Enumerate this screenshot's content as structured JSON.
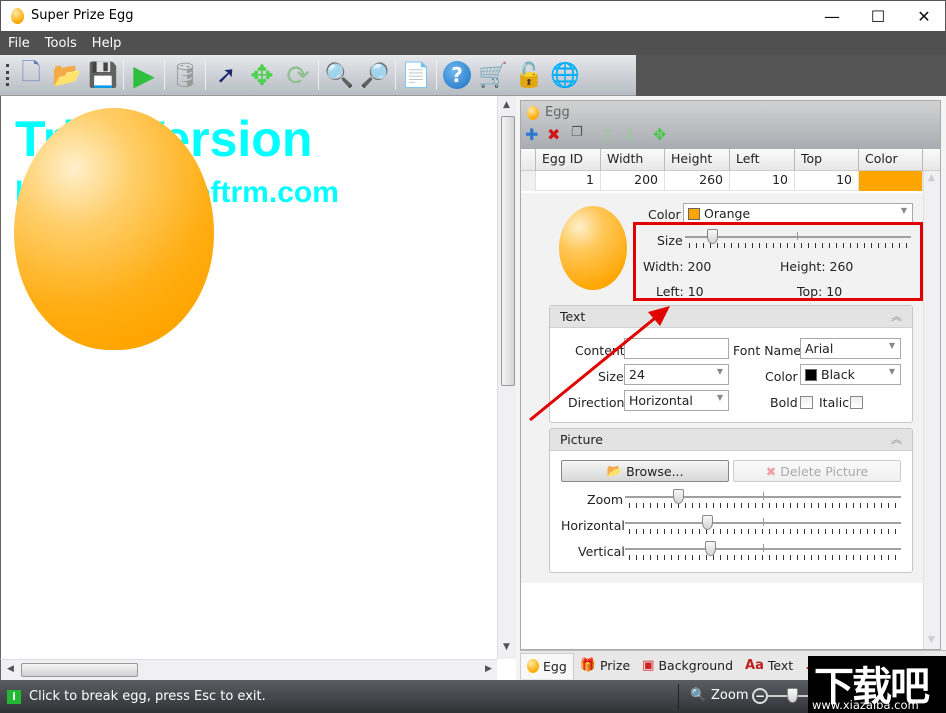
{
  "window": {
    "title": "Super Prize Egg",
    "controls": {
      "minimize": "—",
      "maximize": "☐",
      "close": "✕"
    }
  },
  "menu": [
    "File",
    "Tools",
    "Help"
  ],
  "toolbar": {
    "buttons": [
      {
        "name": "new",
        "icon": "new-document-icon",
        "glyph": "🗋"
      },
      {
        "name": "open",
        "icon": "open-folder-icon",
        "glyph": "📂"
      },
      {
        "name": "save",
        "icon": "save-disk-icon",
        "glyph": "💾"
      },
      {
        "name": "play",
        "icon": "play-icon",
        "glyph": "▶"
      },
      {
        "name": "database",
        "icon": "database-icon",
        "glyph": "🛢"
      },
      {
        "name": "select",
        "icon": "pointer-icon",
        "glyph": "➚"
      },
      {
        "name": "move",
        "icon": "move-arrows-icon",
        "glyph": "✥"
      },
      {
        "name": "reset",
        "icon": "refresh-icon",
        "glyph": "⟳"
      },
      {
        "name": "zoom-in",
        "icon": "zoom-in-icon",
        "glyph": "🔍"
      },
      {
        "name": "zoom-out",
        "icon": "zoom-out-icon",
        "glyph": "🔎"
      },
      {
        "name": "report",
        "icon": "document-icon",
        "glyph": "📄"
      },
      {
        "name": "help",
        "icon": "help-icon",
        "glyph": "?"
      },
      {
        "name": "buy",
        "icon": "cart-icon",
        "glyph": "🛒"
      },
      {
        "name": "register",
        "icon": "unlock-icon",
        "glyph": "🔓"
      },
      {
        "name": "website",
        "icon": "globe-icon",
        "glyph": "🌐"
      }
    ]
  },
  "canvas": {
    "watermark_line1": "Trial Version",
    "watermark_line2": "http://www.softrm.com",
    "egg_color": "#FFA500"
  },
  "egg_panel": {
    "title": "Egg",
    "actions": [
      {
        "name": "add",
        "glyph": "✚",
        "color": "#2a78d0"
      },
      {
        "name": "delete",
        "glyph": "✖",
        "color": "#d01818"
      },
      {
        "name": "copy",
        "glyph": "❐",
        "color": "#666666"
      },
      {
        "name": "move-up",
        "glyph": "⇧",
        "color": "#9ec89e"
      },
      {
        "name": "move-down",
        "glyph": "⇩",
        "color": "#9ec89e"
      },
      {
        "name": "move",
        "glyph": "✥",
        "color": "#44c844"
      }
    ],
    "grid": {
      "columns": [
        "Egg ID",
        "Width",
        "Height",
        "Left",
        "Top",
        "Color"
      ],
      "rows": [
        {
          "id": "1",
          "width": "200",
          "height": "260",
          "left": "10",
          "top": "10",
          "color": "#FFA500"
        }
      ]
    },
    "detail": {
      "color_label": "Color",
      "color_value": "Orange",
      "color_swatch": "#FFA500",
      "size_label": "Size",
      "size_slider_fraction": 0.1,
      "width_text": "Width: 200",
      "height_text": "Height: 260",
      "left_text": "Left: 10",
      "top_text": "Top: 10"
    },
    "text_group": {
      "title": "Text",
      "content_label": "Content",
      "content_value": "",
      "font_name_label": "Font Name",
      "font_name_value": "Arial",
      "size_label": "Size",
      "size_value": "24",
      "color_label": "Color",
      "color_value": "Black",
      "color_swatch": "#000000",
      "direction_label": "Direction",
      "direction_value": "Horizontal",
      "bold_label": "Bold",
      "italic_label": "Italic",
      "bold_checked": false,
      "italic_checked": false
    },
    "picture_group": {
      "title": "Picture",
      "browse_label": "Browse...",
      "delete_label": "Delete Picture",
      "zoom_label": "Zoom",
      "zoom_fraction": 0.18,
      "horizontal_label": "Horizontal",
      "horizontal_fraction": 0.29,
      "vertical_label": "Vertical",
      "vertical_fraction": 0.3
    }
  },
  "tabs": [
    {
      "label": "Egg",
      "icon": "egg-icon",
      "active": true
    },
    {
      "label": "Prize",
      "icon": "gift-icon",
      "active": false
    },
    {
      "label": "Background",
      "icon": "background-icon",
      "active": false
    },
    {
      "label": "Text",
      "icon": "text-icon",
      "active": false
    },
    {
      "label": "",
      "icon": "music-icon",
      "active": false
    }
  ],
  "statusbar": {
    "message": "Click to break egg, press Esc to exit.",
    "zoom_label": "Zoom"
  },
  "overlay_watermark": {
    "chinese": "下载吧",
    "url": "www.xiazaiba.com"
  }
}
